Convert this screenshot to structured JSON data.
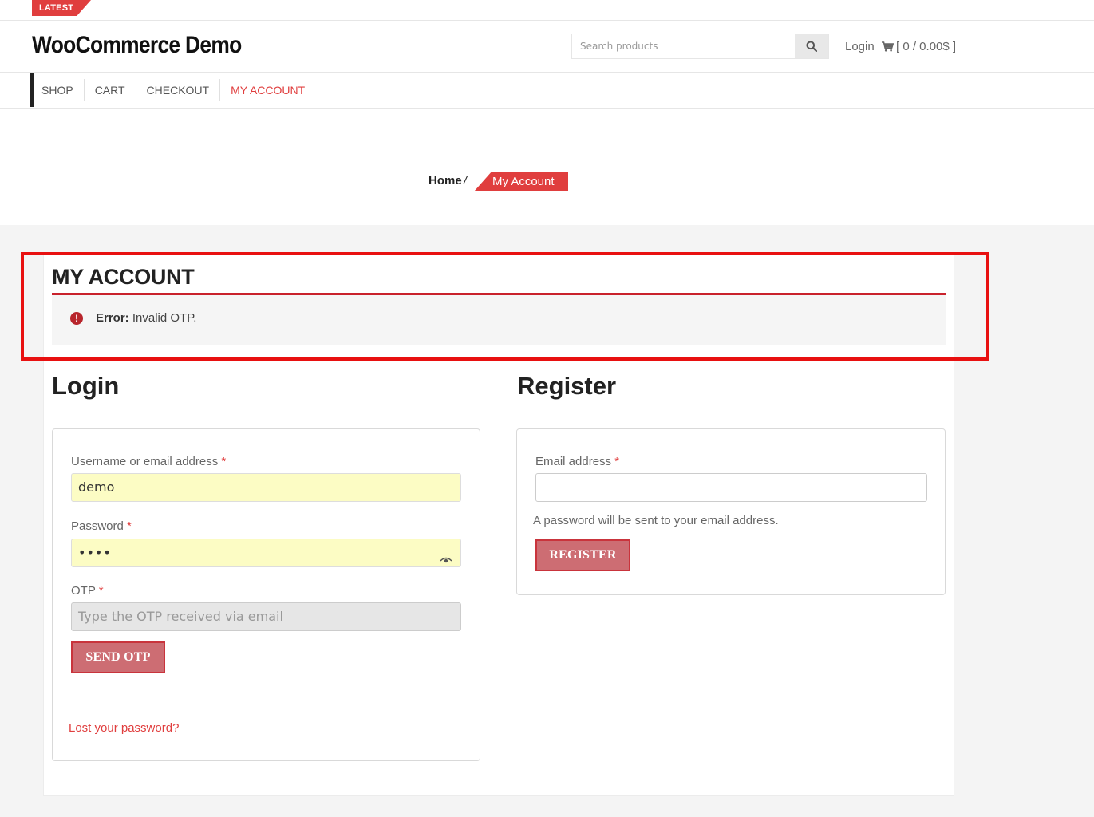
{
  "topbar": {
    "latest_label": "LATEST"
  },
  "header": {
    "site_title": "WooCommerce Demo",
    "search_placeholder": "Search products",
    "login_label": "Login",
    "cart_label": "[ 0 / 0.00$ ]"
  },
  "nav": {
    "items": [
      {
        "label": "SHOP"
      },
      {
        "label": "CART"
      },
      {
        "label": "CHECKOUT"
      },
      {
        "label": "MY ACCOUNT"
      }
    ]
  },
  "breadcrumb": {
    "home": "Home",
    "separator": "/",
    "current": "My Account"
  },
  "page": {
    "title": "MY ACCOUNT",
    "error_prefix": "Error:",
    "error_message": "Invalid OTP."
  },
  "login": {
    "title": "Login",
    "username_label": "Username or email address",
    "username_value": "demo",
    "password_label": "Password",
    "password_value": "••••",
    "otp_label": "OTP",
    "otp_placeholder": "Type the OTP received via email",
    "send_otp_label": "SEND OTP",
    "lost_password_label": "Lost your password?"
  },
  "register": {
    "title": "Register",
    "email_label": "Email address",
    "email_value": "",
    "note": "A password will be sent to your email address.",
    "register_label": "REGISTER"
  },
  "required_marker": "*",
  "colors": {
    "accent": "#e03e3e",
    "button_fill": "#cd6d73",
    "highlight_border": "#e81010",
    "autofill": "#fcfcc4"
  }
}
